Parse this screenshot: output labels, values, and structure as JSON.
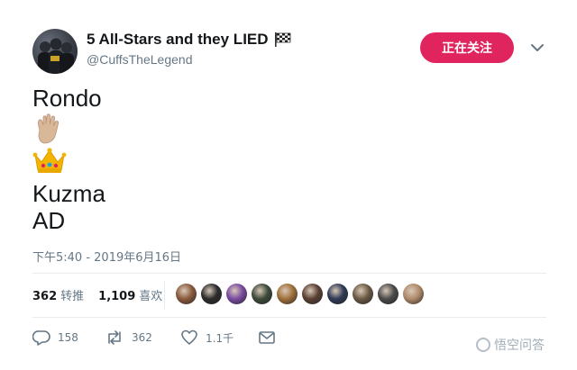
{
  "tweet": {
    "display_name": "5 All-Stars and they LIED",
    "handle": "@CuffsTheLegend",
    "follow_button_label": "正在关注",
    "lines": {
      "line1": "Rondo",
      "line4": "Kuzma",
      "line5": "AD"
    },
    "emojis": [
      "raised-hand-emoji",
      "crown-emoji"
    ],
    "timestamp": "下午5:40 - 2019年6月16日"
  },
  "stats": {
    "retweets_count": "362",
    "retweets_label": "转推",
    "likes_count": "1,109",
    "likes_label": "喜欢",
    "liker_avatar_colors": [
      "#8a5a3c",
      "#2b2b2b",
      "#7a4aa0",
      "#3d4a3a",
      "#a0703a",
      "#5a4034",
      "#2f3a55",
      "#6b5a44",
      "#4a4a4a",
      "#b08a6a"
    ]
  },
  "actions": {
    "reply_count": "158",
    "retweet_count": "362",
    "like_count": "1.1千",
    "icons": [
      "reply-icon",
      "retweet-icon",
      "heart-icon",
      "message-icon"
    ]
  },
  "watermark": {
    "text": "悟空问答"
  },
  "colors": {
    "follow_button": "#e0245e",
    "secondary_text": "#657786",
    "divider": "#e6ecf0"
  }
}
